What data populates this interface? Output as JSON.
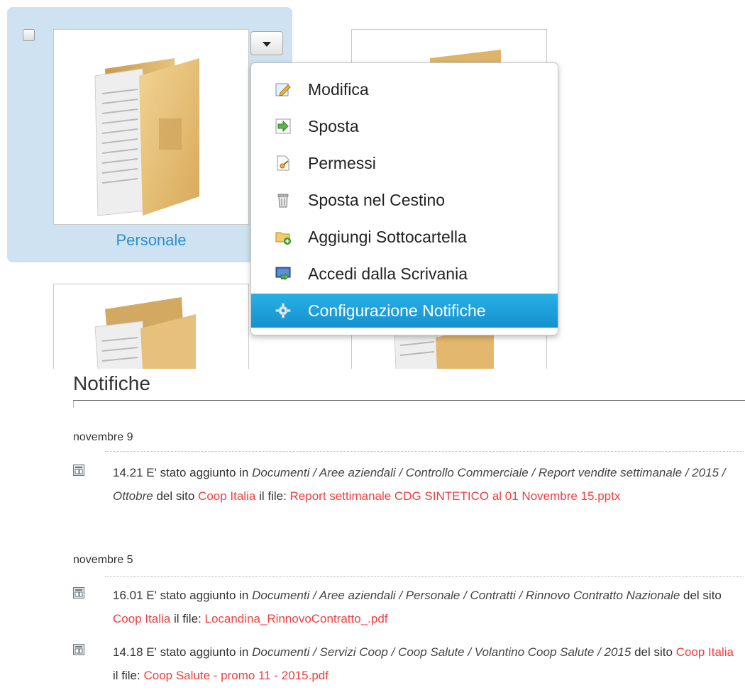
{
  "folders": {
    "selected_label": "Personale"
  },
  "menu": {
    "items": [
      {
        "label": "Modifica",
        "icon": "pencil-icon"
      },
      {
        "label": "Sposta",
        "icon": "arrow-right-icon"
      },
      {
        "label": "Permessi",
        "icon": "key-icon"
      },
      {
        "label": "Sposta nel Cestino",
        "icon": "trash-icon"
      },
      {
        "label": "Aggiungi Sottocartella",
        "icon": "folder-add-icon"
      },
      {
        "label": "Accedi dalla Scrivania",
        "icon": "desktop-icon"
      },
      {
        "label": "Configurazione Notifiche",
        "icon": "gear-icon"
      }
    ],
    "active_index": 6
  },
  "notifications": {
    "title": "Notifiche",
    "groups": [
      {
        "date": "novembre 9",
        "entries": [
          {
            "time": "14.21",
            "prefix": "E' stato aggiunto in",
            "path": "Documenti / Aree aziendali / Controllo Commerciale / Report vendite settimanale / 2015 / Ottobre",
            "site_prefix": "del sito",
            "site": "Coop Italia",
            "file_prefix": "il file:",
            "file": "Report settimanale CDG SINTETICO al 01 Novembre 15.pptx"
          }
        ]
      },
      {
        "date": "novembre 5",
        "entries": [
          {
            "time": "16.01",
            "prefix": "E' stato aggiunto in",
            "path": "Documenti / Aree aziendali / Personale / Contratti / Rinnovo Contratto Nazionale",
            "site_prefix": "del sito",
            "site": "Coop Italia",
            "file_prefix": "il file:",
            "file": "Locandina_RinnovoContratto_.pdf"
          },
          {
            "time": "14.18",
            "prefix": "E' stato aggiunto in",
            "path": "Documenti / Servizi Coop / Coop Salute / Volantino Coop Salute / 2015",
            "site_prefix": "del sito",
            "site": "Coop Italia",
            "file_prefix": "il file:",
            "file": "Coop Salute - promo 11 - 2015.pdf"
          }
        ]
      }
    ]
  },
  "colors": {
    "selection_bg": "#cfe2f1",
    "link_blue": "#2a8fd0",
    "link_red": "#ef3f3f",
    "menu_active": "#1aa3dc"
  }
}
